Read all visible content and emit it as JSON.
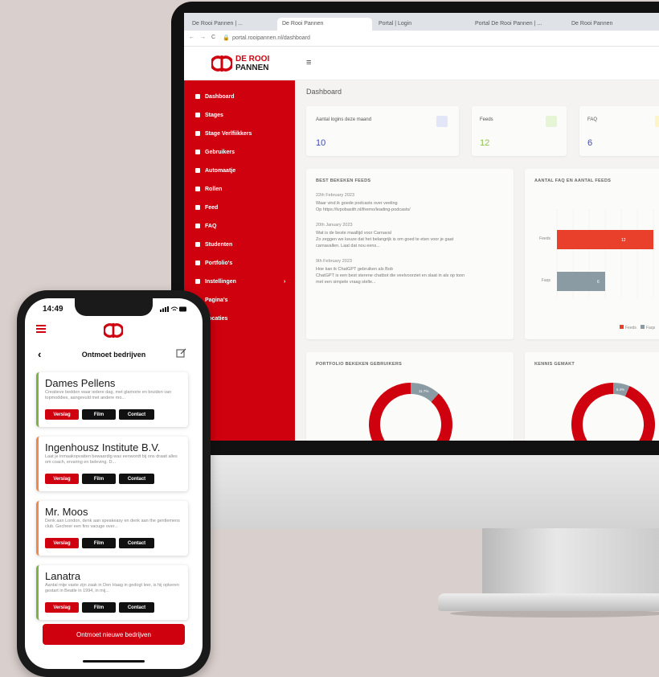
{
  "browser": {
    "tabs": [
      "De Rooi Pannen | ...",
      "De Rooi Pannen",
      "Portal | Login",
      "Portal De Rooi Pannen | ...",
      "De Rooi Pannen"
    ],
    "url": "portal.rooipannen.nl/dashboard"
  },
  "app": {
    "logo_line1": "DE ROOI",
    "logo_line2": "PANNEN",
    "brand_color": "#d0010f",
    "page_title": "Dashboard",
    "sidebar": [
      {
        "label": "Dashboard",
        "icon": "home-icon"
      },
      {
        "label": "Stages",
        "icon": "briefcase-icon"
      },
      {
        "label": "Stage Verlfiikkers",
        "icon": "check-circle-icon"
      },
      {
        "label": "Gebruikers",
        "icon": "user-icon"
      },
      {
        "label": "Automaatje",
        "icon": "lock-icon"
      },
      {
        "label": "Rollen",
        "icon": "gear-icon"
      },
      {
        "label": "Feed",
        "icon": "cloud-icon"
      },
      {
        "label": "FAQ",
        "icon": "square-icon"
      },
      {
        "label": "Studenten",
        "icon": "graduation-icon"
      },
      {
        "label": "Portfolio's",
        "icon": "document-icon"
      },
      {
        "label": "Instellingen",
        "icon": "gear-icon"
      },
      {
        "label": "Pagina's",
        "icon": "page-icon"
      },
      {
        "label": "Locaties",
        "icon": "location-icon"
      }
    ],
    "stats": [
      {
        "label": "Aantal logins deze maand",
        "value": "10",
        "color": "#3b4bb3",
        "badge": "#e3e6f7"
      },
      {
        "label": "Feeds",
        "value": "12",
        "color": "#8bc34a",
        "badge": "#e6f4d7"
      },
      {
        "label": "FAQ",
        "value": "6",
        "color": "#3b4bb3",
        "badge": "#fdf4c8"
      }
    ],
    "news_panel": {
      "title": "BEST BEKEKEN FEEDS",
      "items": [
        {
          "date": "22th February 2023",
          "lines": [
            "Waar vind ik goede podcasts over veeling",
            "Op https://tvpobasith.nl/themo/leading-podcasts/"
          ]
        },
        {
          "date": "20th January 2023",
          "lines": [
            "Wat is de beste maaltijd voor Carnaval",
            "Zo zeggen we keuze dat het belangrijk is om goed te eten voor je gaat",
            "carnavallen. Laat dat nou eens..."
          ]
        },
        {
          "date": "9th February 2023",
          "lines": [
            "Hoe kan ik ChatGPT gebruiken als Bob",
            "ChatGPT is een best sterene chatbot die veelvoorziet en slaat in als op toon",
            "met een simpele vraag stelle..."
          ]
        }
      ]
    },
    "bar_panel": {
      "title": "AANTAL FAQ EN AANTAL FEEDS"
    },
    "donut1_title": "PORTFOLIO BEKEKEN GEBRUIKERS",
    "donut2_title": "KENNIS GEMAKT"
  },
  "chart_data": [
    {
      "type": "bar",
      "orientation": "horizontal",
      "title": "AANTAL FAQ EN AANTAL FEEDS",
      "categories": [
        "Feeds",
        "Faqs"
      ],
      "values": [
        12,
        6
      ],
      "colors": [
        "#e8402a",
        "#8a9ba3"
      ],
      "legend": [
        "Feeds",
        "Faqs"
      ],
      "legend_position": "bottom-right"
    },
    {
      "type": "pie",
      "title": "PORTFOLIO BEKEKEN GEBRUIKERS",
      "slices": [
        {
          "label": "",
          "value": 88.3,
          "color": "#d0010f"
        },
        {
          "label": "11.7%",
          "value": 11.7,
          "color": "#8a9ba3"
        }
      ]
    },
    {
      "type": "pie",
      "title": "KENNIS GEMAKT",
      "slices": [
        {
          "label": "",
          "value": 93.6,
          "color": "#d0010f"
        },
        {
          "label": "6.4%",
          "value": 6.4,
          "color": "#8a9ba3"
        }
      ]
    }
  ],
  "phone": {
    "time": "14:49",
    "title": "Ontmoet bedrijven",
    "companies": [
      {
        "name": "Dames Pellens",
        "desc": "Creatieve bedden waar iedere dag, met glamorie en bruiden van topmoddies, aangevuld met andere mo...",
        "accent": "#7cb342"
      },
      {
        "name": "Ingenhousz Institute B.V.",
        "desc": "Laat je inmaakopvatten bewaardig was eenwordt bij ons draait alles om coach, ervaring en beleving. D...",
        "accent": "#ef8a4a"
      },
      {
        "name": "Mr. Moos",
        "desc": "Denk aan London, denk aan speakeasy en denk aan the gentlemens club. Gecheer een fins vacuge over...",
        "accent": "#ef8a4a"
      },
      {
        "name": "Lanatra",
        "desc": "Aantal mije vaste zijn zaak in Den Haag in gedogt leer, is hij opkeren gestart in Beatle in 1994, in mij...",
        "accent": "#7cb342"
      }
    ],
    "btn_verslag": "Verslag",
    "btn_film": "Film",
    "btn_contact": "Contact",
    "cta": "Ontmoet nieuwe bedrijven"
  }
}
